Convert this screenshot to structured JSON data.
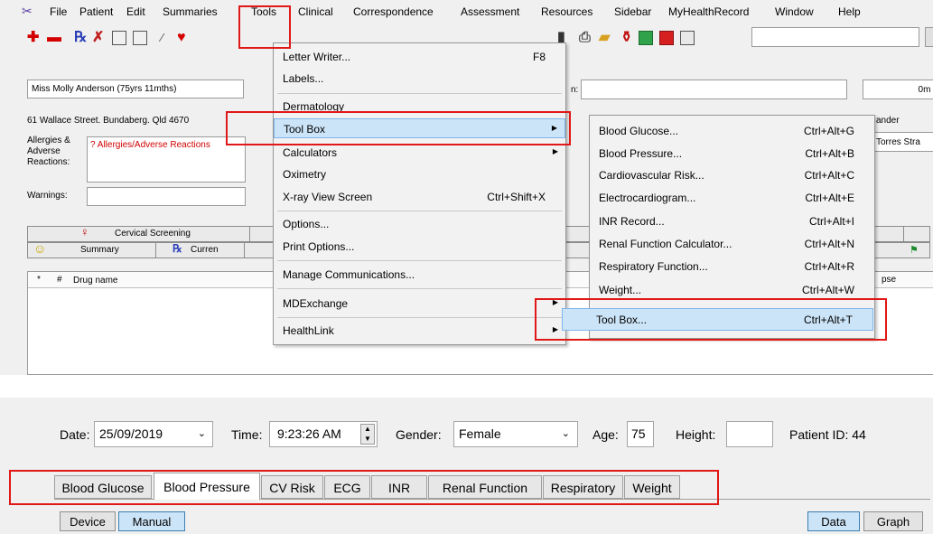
{
  "menubar": {
    "items": [
      "File",
      "Patient",
      "Edit",
      "Summaries",
      "Tools",
      "Clinical",
      "Correspondence",
      "Assessment",
      "Resources",
      "Sidebar",
      "MyHealthRecord",
      "Window",
      "Help"
    ]
  },
  "patient": {
    "name": "Miss Molly Anderson (75yrs 11mths)",
    "address": "61 Wallace Street. Bundaberg. Qld  4670",
    "allergies_label": "Allergies & Adverse Reactions:",
    "allergies_value": "? Allergies/Adverse Reactions",
    "warnings_label": "Warnings:",
    "right_fragment_1": "n:",
    "right_fragment_2": "0m !",
    "right_fragment_3": "ander",
    "right_fragment_4": "Torres Stra"
  },
  "tabs": {
    "row1": [
      "Cervical Screening"
    ],
    "row2": [
      "Summary",
      "Curren"
    ],
    "drug_star": "*",
    "drug_hash": "#",
    "drug_name": "Drug name",
    "drug_right": "pse"
  },
  "tools_menu": {
    "items": [
      {
        "label": "Letter Writer...",
        "shortcut": "F8"
      },
      {
        "label": "Labels..."
      },
      {
        "label": "Dermatology"
      },
      {
        "label": "Tool Box"
      },
      {
        "label": "Calculators"
      },
      {
        "label": "Oximetry"
      },
      {
        "label": "X-ray View Screen",
        "shortcut": "Ctrl+Shift+X"
      },
      {
        "label": "Options..."
      },
      {
        "label": "Print Options..."
      },
      {
        "label": "Manage Communications..."
      },
      {
        "label": "MDExchange"
      },
      {
        "label": "HealthLink"
      }
    ]
  },
  "toolbox_menu": {
    "items": [
      {
        "label": "Blood Glucose...",
        "shortcut": "Ctrl+Alt+G"
      },
      {
        "label": "Blood Pressure...",
        "shortcut": "Ctrl+Alt+B"
      },
      {
        "label": "Cardiovascular Risk...",
        "shortcut": "Ctrl+Alt+C"
      },
      {
        "label": "Electrocardiogram...",
        "shortcut": "Ctrl+Alt+E"
      },
      {
        "label": "INR Record...",
        "shortcut": "Ctrl+Alt+I"
      },
      {
        "label": "Renal Function Calculator...",
        "shortcut": "Ctrl+Alt+N"
      },
      {
        "label": "Respiratory Function...",
        "shortcut": "Ctrl+Alt+R"
      },
      {
        "label": "Weight...",
        "shortcut": "Ctrl+Alt+W"
      },
      {
        "label": "Tool Box...",
        "shortcut": "Ctrl+Alt+T"
      }
    ]
  },
  "toolbox": {
    "date_label": "Date:",
    "date_value": "25/09/2019",
    "time_label": "Time:",
    "time_value": "9:23:26 AM",
    "gender_label": "Gender:",
    "gender_value": "Female",
    "age_label": "Age:",
    "age_value": "75",
    "height_label": "Height:",
    "height_value": "",
    "patient_id": "Patient ID: 44",
    "tabs": [
      "Blood Glucose",
      "Blood Pressure",
      "CV Risk",
      "ECG",
      "INR",
      "Renal Function",
      "Respiratory",
      "Weight"
    ],
    "active_tab": "Blood Pressure",
    "buttons": {
      "device": "Device",
      "manual": "Manual",
      "data": "Data",
      "graph": "Graph"
    }
  },
  "colors": {
    "highlight_box": "#e01818",
    "menu_highlight": "#cce4f7",
    "allergy_text": "#d00000"
  }
}
